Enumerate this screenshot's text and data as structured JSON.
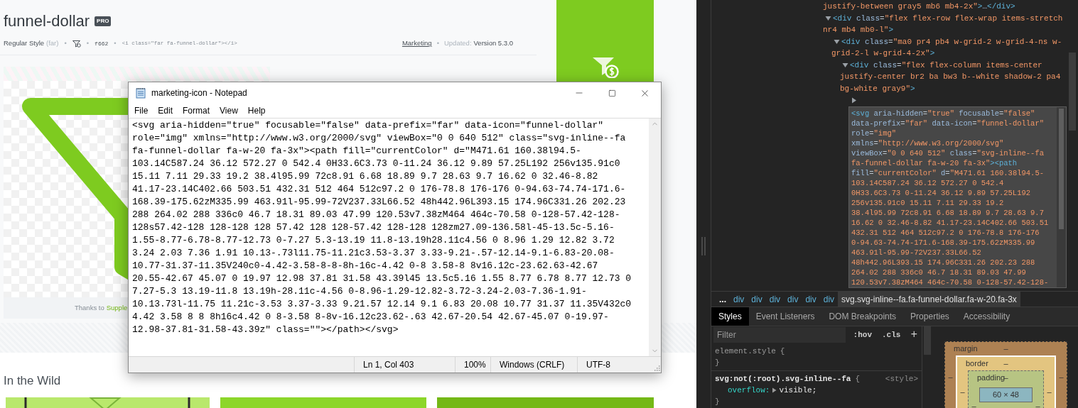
{
  "website": {
    "title": "funnel-dollar",
    "badge": "PRO",
    "meta": {
      "style_name": "Regular Style",
      "style_prefix": "(far)",
      "bullets": [
        "•",
        "•",
        "•",
        "•"
      ],
      "unicode": "f662",
      "snippet": "<i class=\"far fa-funnel-dollar\"></i>",
      "category": "Marketing",
      "updated_label": "Updated:",
      "version": "Version 5.3.0"
    },
    "preview": {
      "credit_prefix": "Thanks to",
      "credit_link": "Supple"
    },
    "in_the_wild": {
      "heading": "In the Wild"
    }
  },
  "notepad": {
    "title": "marketing-icon - Notepad",
    "menu": [
      "File",
      "Edit",
      "Format",
      "View",
      "Help"
    ],
    "lines": [
      "<svg aria-hidden=\"true\" focusable=\"false\" data-prefix=\"far\" data-icon=\"funnel-dollar\"",
      "role=\"img\" xmlns=\"http://www.w3.org/2000/svg\" viewBox=\"0 0 640 512\" class=\"svg-inline--fa",
      "fa-funnel-dollar fa-w-20 fa-3x\"><path fill=\"currentColor\" d=\"M471.61 160.38l94.5-",
      "103.14C587.24 36.12 572.27 0 542.4 0H33.6C3.73 0-11.24 36.12 9.89 57.25L192 256v135.91c0",
      "15.11 7.11 29.33 19.2 38.4l95.99 72c8.91 6.68 18.89 9.7 28.63 9.7 16.62 0 32.46-8.82",
      "41.17-23.14C402.66 503.51 432.31 512 464 512c97.2 0 176-78.8 176-176 0-94.63-74.74-171.6-",
      "168.39-175.62zM335.99 463.91l-95.99-72V237.33L66.52 48h442.96L393.15 174.96C331.26 202.23",
      "288 264.02 288 336c0 46.7 18.31 89.03 47.99 120.53v7.38zM464 464c-70.58 0-128-57.42-128-",
      "128s57.42-128 128-128 128 57.42 128 128-57.42 128-128 128zm27.09-136.58l-45-13.5c-5.16-",
      "1.55-8.77-6.78-8.77-12.73 0-7.27 5.3-13.19 11.8-13.19h28.11c4.56 0 8.96 1.29 12.82 3.72",
      "3.24 2.03 7.36 1.91 10.13-.73l11.75-11.21c3.53-3.37 3.33-9.21-.57-12.14-9.1-6.83-20.08-",
      "10.77-31.37-11.35V240c0-4.42-3.58-8-8-8h-16c-4.42 0-8 3.58-8 8v16.12c-23.62.63-42.67",
      "20.55-42.67 45.07 0 19.97 12.98 37.81 31.58 43.39l45 13.5c5.16 1.55 8.77 6.78 8.77 12.73 0",
      "7.27-5.3 13.19-11.8 13.19h-28.11c-4.56 0-8.96-1.29-12.82-3.72-3.24-2.03-7.36-1.91-",
      "10.13.73l-11.75 11.21c-3.53 3.37-3.33 9.21.57 12.14 9.1 6.83 20.08 10.77 31.37 11.35V432c0",
      "4.42 3.58 8 8 8h16c4.42 0 8-3.58 8-8v-16.12c23.62-.63 42.67-20.54 42.67-45.07 0-19.97-",
      "12.98-37.81-31.58-43.39z\" class=\"\"></path></svg>"
    ],
    "status": [
      "Ln 1, Col 403",
      "100%",
      "Windows (CRLF)",
      "UTF-8"
    ]
  },
  "devtools": {
    "tree": [
      {
        "lines": [
          "justify-between gray5 mb6 mb4-2x\">…</div>"
        ]
      },
      {
        "expanded": true,
        "lines": [
          "<div class=\"flex flex-row flex-wrap items-stretch",
          "nr4 mb4 mb0-l\">"
        ],
        "children": [
          {
            "expanded": true,
            "lines": [
              "<div class=\"ma0 pr4 pb4 w-grid-2 w-grid-4-ns w-",
              "grid-2-l w-grid-4-2x\">"
            ],
            "children": [
              {
                "expanded": true,
                "lines": [
                  "<div class=\"flex flex-column items-center",
                  "justify-center br2 ba bw3 b--white shadow-2 pa4",
                  "bg-white gray9\">"
                ],
                "children": [
                  {
                    "expanded": false,
                    "editing": true,
                    "lines": [
                      "<svg aria-hidden=\"true\" focusable=\"false\"",
                      "data-prefix=\"far\" data-icon=\"funnel-dollar\"",
                      "role=\"img\"",
                      "xmlns=\"http://www.w3.org/2000/svg\"",
                      "viewBox=\"0 0 640 512\" class=\"svg-inline--fa",
                      "fa-funnel-dollar fa-w-20 fa-3x\"><path",
                      "fill=\"currentColor\" d=\"M471.61 160.38l94.5-",
                      "103.14C587.24 36.12 572.27 0 542.4",
                      "0H33.6C3.73 0-11.24 36.12 9.89 57.25L192",
                      "256v135.91c0 15.11 7.11 29.33 19.2",
                      "38.4l95.99 72c8.91 6.68 18.89 9.7 28.63 9.7",
                      "16.62 0 32.46-8.82 41.17-23.14C402.66 503.51",
                      "432.31 512 464 512c97.2 0 176-78.8 176-176",
                      "0-94.63-74.74-171.6-168.39-175.62zM335.99",
                      "463.91l-95.99-72V237.33L66.52",
                      "48h442.96L393.15 174.96C331.26 202.23 288",
                      "264.02 288 336c0 46.7 18.31 89.03 47.99",
                      "120.53v7.38zM464 464c-70.58 0-128-57.42-128-"
                    ]
                  }
                ]
              }
            ]
          }
        ]
      }
    ],
    "breadcrumb": [
      {
        "label": "...",
        "selected": false
      },
      {
        "label": "div",
        "selected": false
      },
      {
        "label": "div",
        "selected": false
      },
      {
        "label": "div",
        "selected": false
      },
      {
        "label": "div",
        "selected": false
      },
      {
        "label": "div",
        "selected": false
      },
      {
        "label": "div",
        "selected": false
      },
      {
        "label": "svg.svg-inline--fa.fa-funnel-dollar.fa-w-20.fa-3x",
        "selected": true
      }
    ],
    "tabs": [
      {
        "label": "Styles",
        "selected": true
      },
      {
        "label": "Event Listeners",
        "selected": false
      },
      {
        "label": "DOM Breakpoints",
        "selected": false
      },
      {
        "label": "Properties",
        "selected": false
      },
      {
        "label": "Accessibility",
        "selected": false
      }
    ],
    "styles": {
      "filter_placeholder": "Filter",
      "tools": [
        ":hov",
        ".cls",
        "+"
      ],
      "rules": [
        {
          "selector": "element.style",
          "open": "{",
          "close": "}"
        },
        {
          "selector": "svg:not(:root).svg-inline--fa",
          "open": "{",
          "source": "<style>",
          "declarations": [
            {
              "property": "overflow:",
              "value": "visible;",
              "expandable": true
            }
          ],
          "close": "}"
        }
      ]
    },
    "box_model": {
      "margin": {
        "label": "margin",
        "top": "–",
        "left": "–",
        "right": "–"
      },
      "border": {
        "label": "border",
        "top": "–",
        "left": "–",
        "right": "–"
      },
      "padding": {
        "label": "padding",
        "top": "–",
        "left": "–",
        "right": "–"
      },
      "content": "60 × 48"
    }
  }
}
